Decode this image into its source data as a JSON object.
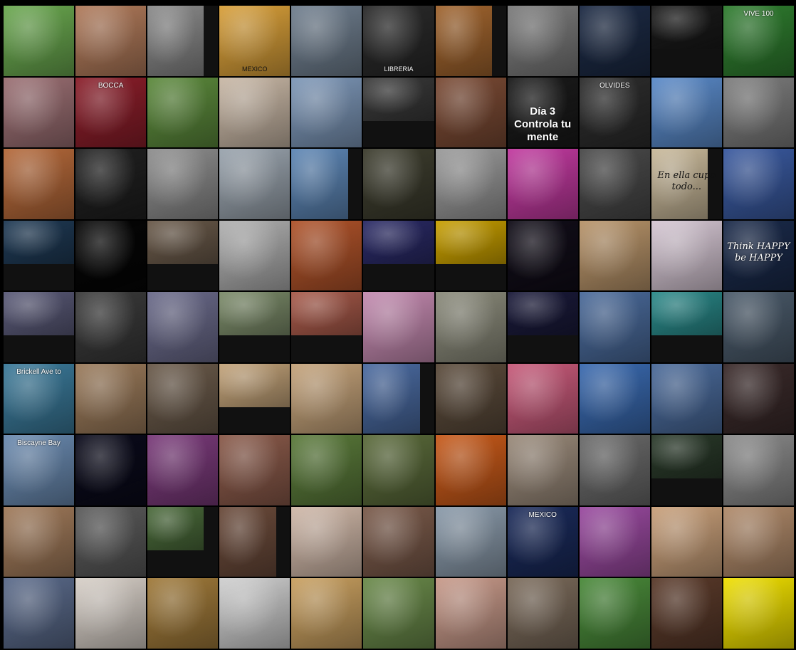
{
  "gallery": {
    "tiles": [
      {
        "c": "#6aa84f"
      },
      {
        "c": "#b07a5a"
      },
      {
        "c": "#8a8a8a"
      },
      {
        "c": "#d9a03a",
        "text": "MEXICO",
        "pos": "bottom",
        "dark": true
      },
      {
        "c": "#6f7e8e"
      },
      {
        "c": "#2a2a2a",
        "text": "LIBRERIA",
        "pos": "bottom"
      },
      {
        "c": "#a0642e"
      },
      {
        "c": "#7b7b7b"
      },
      {
        "c": "#1c2a44"
      },
      {
        "c": "#1a1a1a"
      },
      {
        "c": "#2f7d2f",
        "text": "VIVE 100",
        "pos": "top"
      },
      {
        "c": "#9b6f73"
      },
      {
        "c": "#8b1e2a",
        "text": "BOCCA",
        "pos": "top"
      },
      {
        "c": "#5c8a3c"
      },
      {
        "c": "#c9b8a6"
      },
      {
        "c": "#7d97b8"
      },
      {
        "c": "#3a3a3a"
      },
      {
        "c": "#7a4a34"
      },
      {
        "c": "#1a1a1a",
        "text": "Día 3 Controla tu mente",
        "pos": "mid"
      },
      {
        "c": "#2d2d2d",
        "text": "OLVIDES",
        "pos": "top"
      },
      {
        "c": "#5a8ac9"
      },
      {
        "c": "#7d7d7d"
      },
      {
        "c": "#b5693a"
      },
      {
        "c": "#202020"
      },
      {
        "c": "#8e8e8e"
      },
      {
        "c": "#9aa4ae"
      },
      {
        "c": "#5d86b5"
      },
      {
        "c": "#3d3d2e"
      },
      {
        "c": "#9a9a9a"
      },
      {
        "c": "#c23aa0"
      },
      {
        "c": "#4a4a4a"
      },
      {
        "c": "#c9b99a",
        "text": "En ella cupo todo...",
        "pos": "script",
        "dark": true
      },
      {
        "c": "#3a5aa0"
      },
      {
        "c": "#1f3a55"
      },
      {
        "c": "#0a0a0a"
      },
      {
        "c": "#6a5a4a"
      },
      {
        "c": "#b0b0b0"
      },
      {
        "c": "#b0532a"
      },
      {
        "c": "#2a2a66"
      },
      {
        "c": "#c9a000"
      },
      {
        "c": "#110d18"
      },
      {
        "c": "#b8946a"
      },
      {
        "c": "#d6c7d4"
      },
      {
        "c": "#1a2a4a",
        "text": "Think HAPPY be HAPPY",
        "pos": "script"
      },
      {
        "c": "#5a5a78"
      },
      {
        "c": "#3a3a3a"
      },
      {
        "c": "#6a6a8a"
      },
      {
        "c": "#7c8c6a"
      },
      {
        "c": "#a85a4a"
      },
      {
        "c": "#c48ab0"
      },
      {
        "c": "#8a8a7a"
      },
      {
        "c": "#1a1a3a"
      },
      {
        "c": "#4a6a9a"
      },
      {
        "c": "#2a8a8a"
      },
      {
        "c": "#4a5a6a"
      },
      {
        "c": "#3b7a9a",
        "text": "Brickell Ave to",
        "pos": "top"
      },
      {
        "c": "#9a7a5a"
      },
      {
        "c": "#6a5a4a"
      },
      {
        "c": "#c4a47a"
      },
      {
        "c": "#c5a37a"
      },
      {
        "c": "#4a6aa0"
      },
      {
        "c": "#5a4a3a"
      },
      {
        "c": "#c85a7a"
      },
      {
        "c": "#3a6ab0"
      },
      {
        "c": "#4a6a9a"
      },
      {
        "c": "#3a2a2a"
      },
      {
        "c": "#6a8ab0",
        "text": "Biscayne Bay",
        "pos": "top"
      },
      {
        "c": "#0a0a1a"
      },
      {
        "c": "#7a3a7a"
      },
      {
        "c": "#8a5a4a"
      },
      {
        "c": "#5a7a3a"
      },
      {
        "c": "#5a6a3a"
      },
      {
        "c": "#c85a1a"
      },
      {
        "c": "#9a8a7a"
      },
      {
        "c": "#6a6a6a"
      },
      {
        "c": "#2a3a2a"
      },
      {
        "c": "#8a8a8a"
      },
      {
        "c": "#a07a5a"
      },
      {
        "c": "#5a5a5a"
      },
      {
        "c": "#4a6a3a"
      },
      {
        "c": "#6a4a3a"
      },
      {
        "c": "#d0b8a8"
      },
      {
        "c": "#7a5a4a"
      },
      {
        "c": "#8a9aaa"
      },
      {
        "c": "#1a2a5a",
        "text": "MEXICO",
        "pos": "top"
      },
      {
        "c": "#9a4aa0"
      },
      {
        "c": "#c9a07a"
      },
      {
        "c": "#b08a6a"
      },
      {
        "c": "#5a6a8a"
      },
      {
        "c": "#d8d0c8"
      },
      {
        "c": "#a07a3a"
      },
      {
        "c": "#d0d0d0"
      },
      {
        "c": "#c9a060"
      },
      {
        "c": "#6a8a4a"
      },
      {
        "c": "#c89a8a"
      },
      {
        "c": "#7a6a5a"
      },
      {
        "c": "#4a8a3a"
      },
      {
        "c": "#5a3a2a"
      },
      {
        "c": "#f0e000"
      }
    ]
  }
}
